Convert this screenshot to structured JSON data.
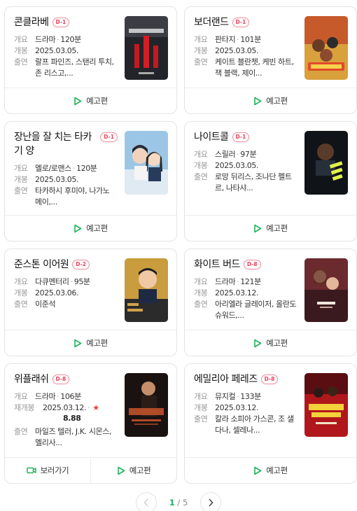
{
  "labels": {
    "genre": "개요",
    "release": "개봉",
    "rerelease": "재개봉",
    "cast": "출연",
    "trailer": "예고편",
    "watch": "보러가기"
  },
  "movies": [
    {
      "title": "콘클라베",
      "badge": "D-1",
      "genre": "드라마",
      "runtime": "120분",
      "release_key": "개봉",
      "release": "2025.03.05.",
      "cast": "랄프 파인즈, 스탠리 투치, 존 리스고,..."
    },
    {
      "title": "보더랜드",
      "badge": "D-1",
      "genre": "판타지",
      "runtime": "101분",
      "release_key": "개봉",
      "release": "2025.03.05.",
      "cast": "케이트 블란쳇, 케빈 하트, 잭 블랙, 제이..."
    },
    {
      "title": "장난을 잘 치는 타카기 양",
      "badge": "D-1",
      "genre": "멜로/로맨스",
      "runtime": "120분",
      "release_key": "개봉",
      "release": "2025.03.05.",
      "cast": "타카하시 후미야, 나가노 메이,..."
    },
    {
      "title": "나이트콜",
      "badge": "D-1",
      "genre": "스릴러",
      "runtime": "97분",
      "release_key": "개봉",
      "release": "2025.03.05.",
      "cast": "로망 뒤리스, 조나단 펠트르, 나타샤..."
    },
    {
      "title": "준스톤 이어원",
      "badge": "D-2",
      "genre": "다큐멘터리",
      "runtime": "95분",
      "release_key": "개봉",
      "release": "2025.03.06.",
      "cast": "이준석"
    },
    {
      "title": "화이트 버드",
      "badge": "D-8",
      "genre": "드라마",
      "runtime": "121분",
      "release_key": "개봉",
      "release": "2025.03.12.",
      "cast": "아리엘라 글레이저, 올란도 슈워드,..."
    },
    {
      "title": "위플래쉬",
      "badge": "D-8",
      "genre": "드라마",
      "runtime": "106분",
      "release_key": "재개봉",
      "release": "2025.03.12.",
      "rating": "8.88",
      "cast": "마일즈 텔러, J.K. 시몬스, 멜리사..."
    },
    {
      "title": "에밀리아 페레즈",
      "badge": "D-8",
      "genre": "뮤지컬",
      "runtime": "133분",
      "release_key": "개봉",
      "release": "2025.03.12.",
      "cast": "칼라 소피아 가스콘, 조 샐다나, 셀레나..."
    }
  ],
  "pagination": {
    "current": "1",
    "separator": "/",
    "total": "5"
  },
  "colors": {
    "badge": "#e8405a",
    "accent": "#1fb35a",
    "star": "#e83e3e"
  }
}
